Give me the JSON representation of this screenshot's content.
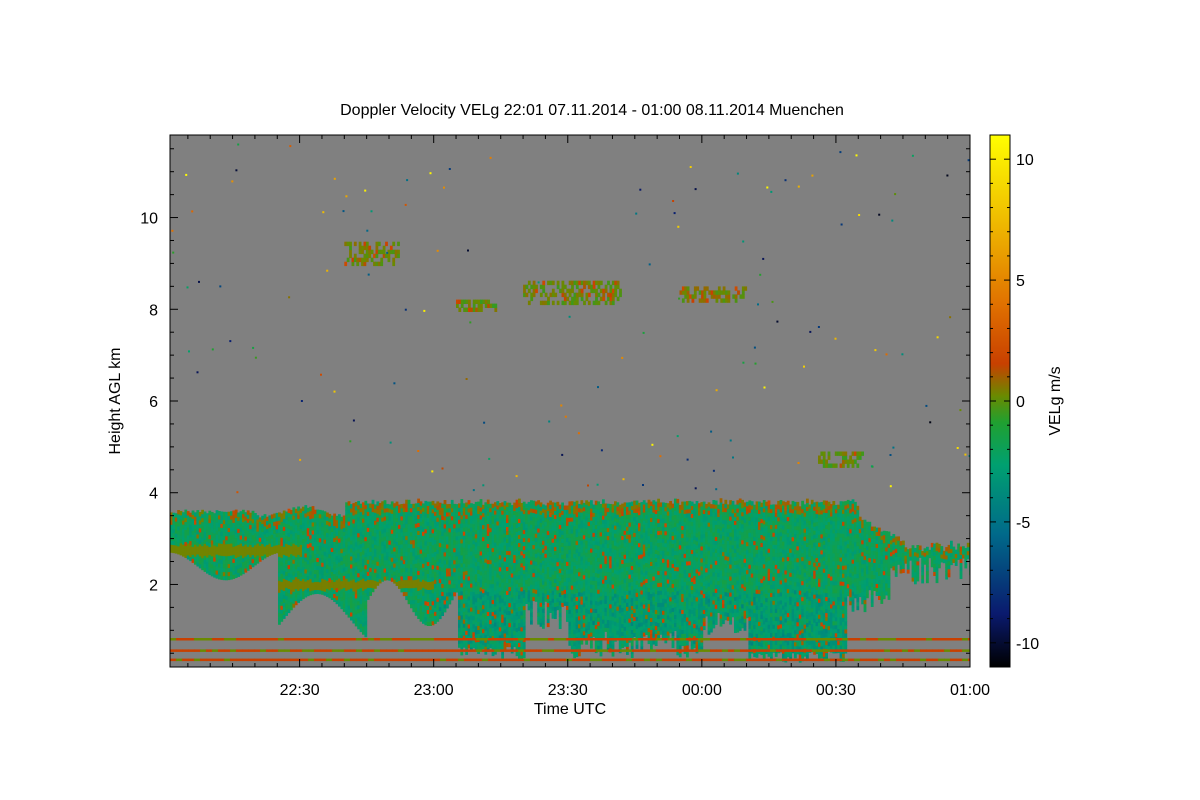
{
  "chart_data": {
    "type": "heatmap",
    "title": "Doppler Velocity VELg   22:01 07.11.2014 - 01:00 08.11.2014 Muenchen",
    "xlabel": "Time UTC",
    "ylabel": "Height AGL km",
    "colorbar_label": "VELg m/s",
    "x_range_minutes": [
      -119,
      60
    ],
    "x_tick_values": [
      -90,
      -60,
      -30,
      0,
      30,
      60
    ],
    "x_tick_labels": [
      "22:30",
      "23:00",
      "23:30",
      "00:00",
      "00:30",
      "01:00"
    ],
    "y_range_km": [
      0.2,
      11.8
    ],
    "y_tick_values": [
      2,
      4,
      6,
      8,
      10
    ],
    "y_tick_labels": [
      "2",
      "4",
      "6",
      "8",
      "10"
    ],
    "colorbar_range": [
      -11,
      11
    ],
    "colorbar_tick_values": [
      -10,
      -5,
      0,
      5,
      10
    ],
    "colorbar_tick_labels": [
      "-10",
      "-5",
      "0",
      "5",
      "10"
    ],
    "background_color": "#808080",
    "colormap": [
      "#000000",
      "#0a1a6e",
      "#006a8a",
      "#00a070",
      "#20a030",
      "#6a8a00",
      "#c84000",
      "#e07000",
      "#f0c000",
      "#ffff00"
    ],
    "regions": [
      {
        "name": "lower-cloud-layer",
        "t_start": -119,
        "t_end": 60,
        "h_bottom": 0.3,
        "h_top": 3.7,
        "velocity": -1.5
      },
      {
        "name": "cloud-layer-8.3km",
        "t_start": -40,
        "t_end": 10,
        "h_bottom": 7.9,
        "h_top": 8.6,
        "velocity": -0.5
      },
      {
        "name": "cloud-layer-9.2km",
        "t_start": -80,
        "t_end": -68,
        "h_bottom": 8.9,
        "h_top": 9.5,
        "velocity": -0.5
      },
      {
        "name": "cloud-patch-4.8km",
        "t_start": 26,
        "t_end": 36,
        "h_bottom": 4.5,
        "h_top": 4.9,
        "velocity": -0.5
      }
    ]
  }
}
